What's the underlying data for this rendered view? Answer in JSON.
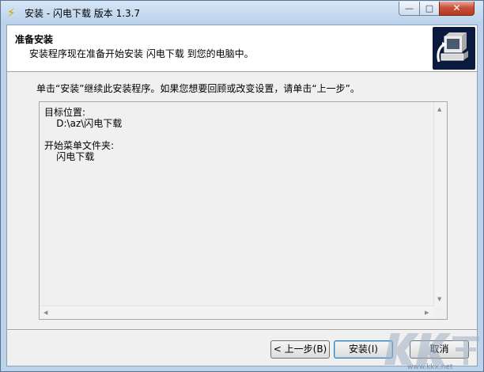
{
  "window": {
    "title": "安装 - 闪电下载 版本 1.3.7",
    "min_label": "—",
    "max_label": "□",
    "close_label": "✕"
  },
  "header": {
    "title": "准备安装",
    "subtitle": "安装程序现在准备开始安装 闪电下载 到您的电脑中。"
  },
  "body": {
    "instruction": "单击“安装”继续此安装程序。如果您想要回顾或改变设置，请单击“上一步”。"
  },
  "memo": {
    "lines": [
      "目标位置:",
      "    D:\\az\\闪电下载",
      "",
      "开始菜单文件夹:",
      "    闪电下载"
    ]
  },
  "buttons": {
    "back": "< 上一步(B)",
    "install": "安装(I)",
    "cancel": "取消"
  },
  "watermark": {
    "url": "www.kkx.net"
  },
  "colors": {
    "title_gradient_top": "#d6e6f6",
    "close_button": "#c7503a",
    "dialog_bg": "#f0f0f0",
    "header_bg": "#ffffff",
    "wizard_image_bg": "#0a1a3e"
  }
}
